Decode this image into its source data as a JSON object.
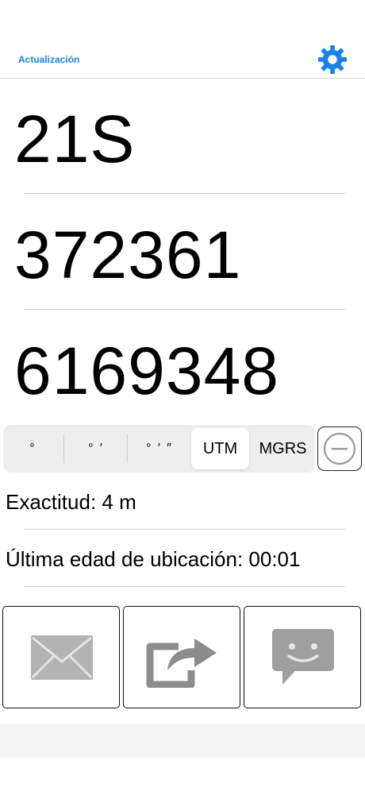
{
  "header": {
    "update_link": "Actualización",
    "settings_icon": "gear-icon"
  },
  "coordinates": {
    "zone": "21S",
    "easting": "372361",
    "northing": "6169348"
  },
  "format_selector": {
    "options": [
      "°",
      "° ′",
      "° ′ ″",
      "UTM",
      "MGRS"
    ],
    "selected": "UTM"
  },
  "toggle_icon": "minus-circle-icon",
  "info": {
    "accuracy": "Exactitud: 4 m",
    "last_location_age": "Última edad de ubicación: 00:01"
  },
  "actions": [
    {
      "name": "email",
      "icon": "envelope-icon"
    },
    {
      "name": "share",
      "icon": "share-arrow-icon"
    },
    {
      "name": "message",
      "icon": "chat-bubble-icon"
    }
  ],
  "colors": {
    "accent": "#1a82e6",
    "icon_gray": "#9a9a9a"
  }
}
